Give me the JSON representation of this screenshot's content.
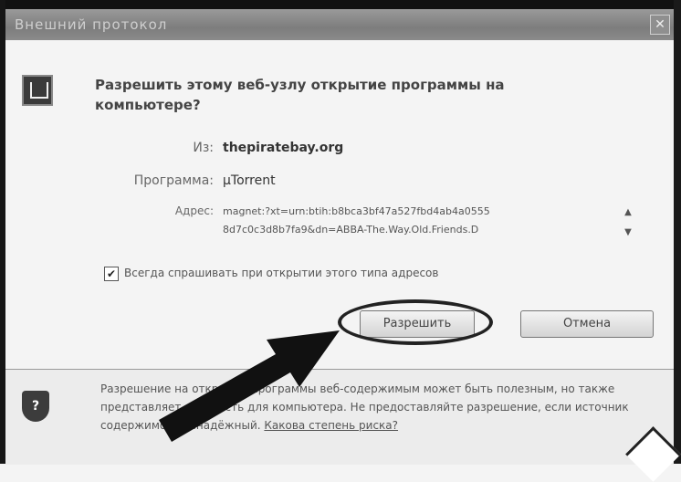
{
  "window": {
    "title": "Внешний протокол",
    "close_label": "✕"
  },
  "dialog": {
    "question": "Разрешить этому веб-узлу открытие программы на компьютере?",
    "from_label": "Из:",
    "from_value": "thepiratebay.org",
    "program_label": "Программа:",
    "program_value": "µTorrent",
    "address_label": "Адрес:",
    "address_line1": "magnet:?xt=urn:btih:b8bca3bf47a527fbd4ab4a0555",
    "address_line2": "8d7c0c3d8b7fa9&dn=ABBA-The.Way.Old.Friends.D",
    "checkbox_label": "Всегда спрашивать при открытии этого типа адресов",
    "checkbox_checked": true,
    "allow_label": "Разрешить",
    "cancel_label": "Отмена"
  },
  "footer": {
    "text": "Разрешение на открытие программы веб-содержимым может быть полезным, но также представляет опасность для компьютера. Не предоставляйте разрешение, если источник содержимого ненадёжный.",
    "link_label": "Какова степень риска?"
  },
  "colors": {
    "titlebar": "#8a8a8a",
    "dialog_bg": "#f4f4f4",
    "arrow": "#111111"
  }
}
